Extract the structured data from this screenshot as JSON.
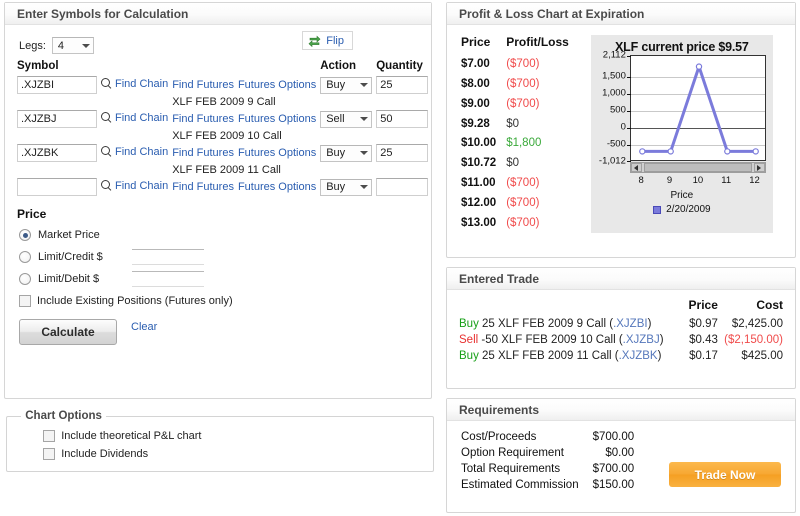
{
  "left": {
    "header": "Enter Symbols for Calculation",
    "legs_label": "Legs:",
    "legs_value": "4",
    "columns": {
      "symbol": "Symbol",
      "action": "Action",
      "quantity": "Quantity"
    },
    "links": {
      "find_chain": "Find Chain",
      "find_futures": "Find Futures",
      "futures_options": "Futures Options"
    },
    "rows": [
      {
        "symbol": ".XJZBI",
        "description": "XLF FEB 2009 9 Call",
        "action": "Buy",
        "quantity": "25"
      },
      {
        "symbol": ".XJZBJ",
        "description": "XLF FEB 2009 10 Call",
        "action": "Sell",
        "quantity": "50"
      },
      {
        "symbol": ".XJZBK",
        "description": "XLF FEB 2009 11 Call",
        "action": "Buy",
        "quantity": "25"
      },
      {
        "symbol": "",
        "description": "",
        "action": "Buy",
        "quantity": ""
      }
    ],
    "price": {
      "title": "Price",
      "flip_label": "Flip",
      "market_label": "Market Price",
      "limit_credit_label": "Limit/Credit $",
      "limit_credit_value": "",
      "limit_debit_label": "Limit/Debit $",
      "limit_debit_value": "",
      "include_positions_label": "Include Existing Positions (Futures only)"
    },
    "calculate_label": "Calculate",
    "clear_label": "Clear",
    "chart_options": {
      "legend": "Chart Options",
      "theoretical_label": "Include theoretical P&L chart",
      "dividends_label": "Include Dividends"
    }
  },
  "pl": {
    "header": "Profit & Loss Chart at Expiration",
    "columns": {
      "price": "Price",
      "profit_loss": "Profit/Loss"
    },
    "rows": [
      {
        "price": "$7.00",
        "value": "($700)",
        "sign": "neg"
      },
      {
        "price": "$8.00",
        "value": "($700)",
        "sign": "neg"
      },
      {
        "price": "$9.00",
        "value": "($700)",
        "sign": "neg"
      },
      {
        "price": "$9.28",
        "value": "$0",
        "sign": "zero"
      },
      {
        "price": "$10.00",
        "value": "$1,800",
        "sign": "pos"
      },
      {
        "price": "$10.72",
        "value": "$0",
        "sign": "zero"
      },
      {
        "price": "$11.00",
        "value": "($700)",
        "sign": "neg"
      },
      {
        "price": "$12.00",
        "value": "($700)",
        "sign": "neg"
      },
      {
        "price": "$13.00",
        "value": "($700)",
        "sign": "neg"
      }
    ]
  },
  "chart_data": {
    "type": "line",
    "title": "XLF current price $9.57",
    "xlabel": "Price",
    "ylabel": "",
    "x": [
      8,
      9,
      10,
      11,
      12
    ],
    "values": [
      -700,
      -700,
      1800,
      -700,
      -700
    ],
    "series": [
      {
        "name": "2/20/2009",
        "values": [
          -700,
          -700,
          1800,
          -700,
          -700
        ],
        "color": "#7b7bdb"
      }
    ],
    "xticks": [
      "8",
      "9",
      "10",
      "11",
      "12"
    ],
    "yticks": [
      "2,112",
      "1,500",
      "1,000",
      "500",
      "0",
      "-500",
      "-1,012"
    ],
    "ytick_values": [
      2112,
      1500,
      1000,
      500,
      0,
      -500,
      -1012
    ],
    "ylim": [
      -1012,
      2112
    ],
    "xlim": [
      7.6,
      12.4
    ],
    "grid": true,
    "legend": [
      "2/20/2009"
    ],
    "legend_position": "bottom",
    "marker": "circle",
    "scrollbar": true
  },
  "trade": {
    "header": "Entered Trade",
    "columns": {
      "price": "Price",
      "cost": "Cost"
    },
    "rows": [
      {
        "action": "Buy",
        "side": "buy",
        "detail": " 25 XLF FEB 2009 9 Call (",
        "symbol": ".XJZBI",
        "close": ")",
        "price": "$0.97",
        "cost": "$2,425.00",
        "cost_sign": "pos"
      },
      {
        "action": "Sell",
        "side": "sell",
        "detail": " -50 XLF FEB 2009 10 Call (",
        "symbol": ".XJZBJ",
        "close": ")",
        "price": "$0.43",
        "cost": "($2,150.00)",
        "cost_sign": "neg"
      },
      {
        "action": "Buy",
        "side": "buy",
        "detail": " 25 XLF FEB 2009 11 Call (",
        "symbol": ".XJZBK",
        "close": ")",
        "price": "$0.17",
        "cost": "$425.00",
        "cost_sign": "pos"
      }
    ]
  },
  "requirements": {
    "header": "Requirements",
    "rows": [
      {
        "label": "Cost/Proceeds",
        "value": "$700.00"
      },
      {
        "label": "Option Requirement",
        "value": "$0.00"
      },
      {
        "label": "Total Requirements",
        "value": "$700.00"
      },
      {
        "label": "Estimated Commission",
        "value": "$150.00"
      }
    ],
    "trade_now_label": "Trade Now"
  },
  "colors": {
    "link": "#2a5db0",
    "buy": "#18a018",
    "sell": "#e83030",
    "negative": "#f04b4b",
    "positive": "#3aa93a",
    "chart_line": "#7b7bdb",
    "trade_now": "#f7a732"
  }
}
